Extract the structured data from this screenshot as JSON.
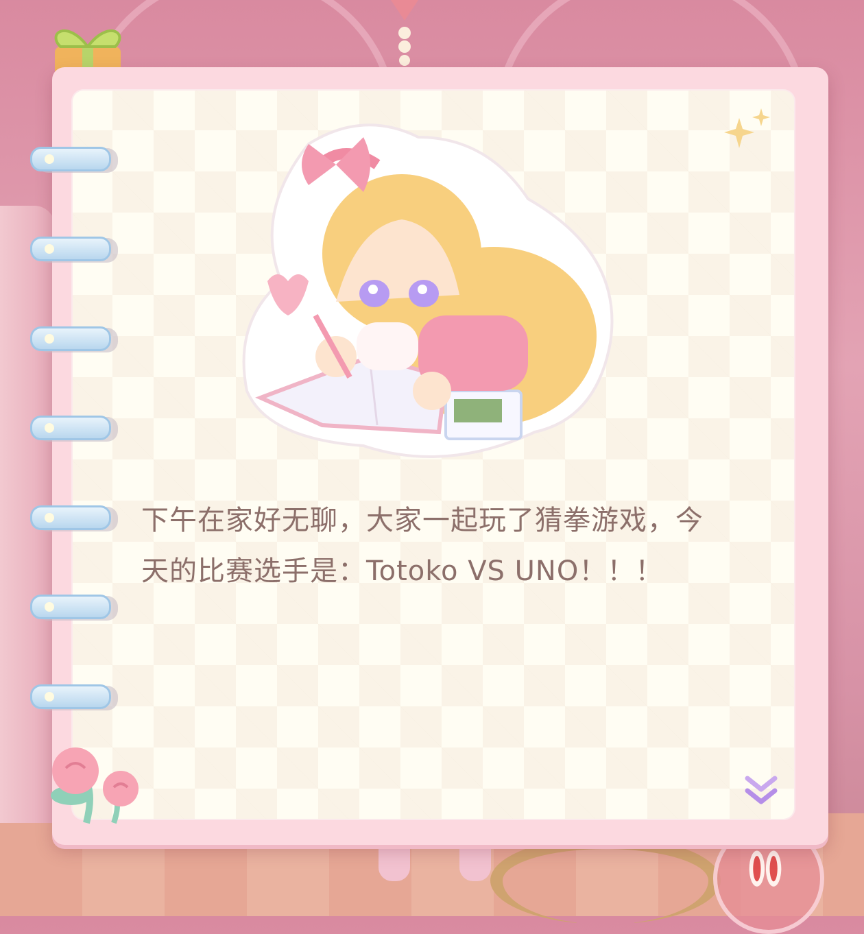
{
  "diary": {
    "text_line1": "下午在家好无聊，大家一起玩了猜拳游戏，今",
    "text_line2": "天的比赛选手是：Totoko VS UNO！！！"
  },
  "icons": {
    "gift": "gift-icon",
    "sparkle": "sparkle-icon",
    "flower": "rose-flower-icon",
    "next": "double-chevron-down-icon",
    "rabbit": "rabbit-footprint-icon"
  },
  "colors": {
    "frame": "#fcd9e0",
    "page": "#fffdf3",
    "text": "#8c6f6a",
    "ring": "#b9d7ee",
    "chevron": "#c9a8ee"
  }
}
